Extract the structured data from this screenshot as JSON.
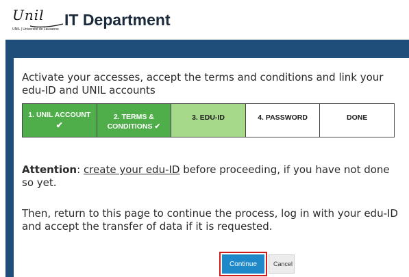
{
  "header": {
    "logo_script": "Unil",
    "logo_sub": "UNIL | Université de Lausanne",
    "title": "IT Department"
  },
  "intro": {
    "text": "Activate your accesses, accept the terms and conditions and link your edu-ID and UNIL accounts"
  },
  "steps": [
    {
      "label": "1. UNIL ACCOUNT",
      "check": "✔",
      "state": "done"
    },
    {
      "label": "2. TERMS & CONDITIONS ✔",
      "state": "done"
    },
    {
      "label": "3. EDU-ID",
      "state": "current"
    },
    {
      "label": "4. PASSWORD",
      "state": "pending"
    },
    {
      "label": "DONE",
      "state": "pending"
    }
  ],
  "attention": {
    "label": "Attention",
    "sep": ": ",
    "link_text": "create your edu-ID",
    "rest": " before proceeding, if you have not done so yet."
  },
  "return_text": "Then, return to this page to continue the process, log in with your edu-ID and accept the transfer of data if it is requested.",
  "buttons": {
    "continue": "Continue",
    "cancel": "Cancel"
  },
  "colors": {
    "frame": "#1f4e7a",
    "step_done": "#4fae4a",
    "step_current": "#a7d98a",
    "continue_bg": "#1e88c8",
    "highlight": "#d21b1b"
  }
}
